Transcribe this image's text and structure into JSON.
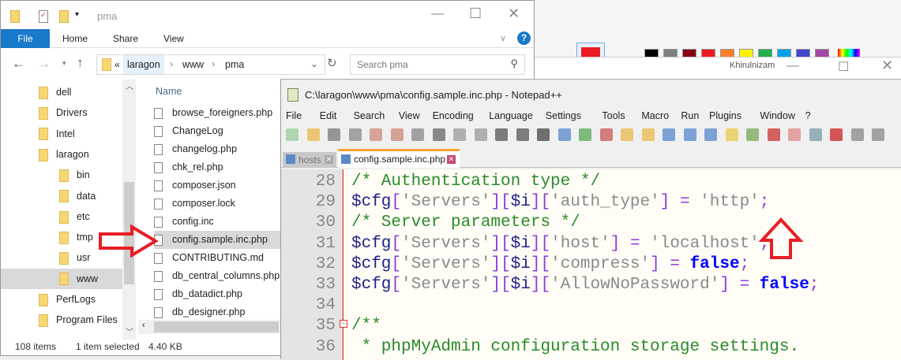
{
  "explorer": {
    "title": "pma",
    "tabs": [
      "File",
      "Home",
      "Share",
      "View"
    ],
    "breadcrumb": [
      "«",
      "laragon",
      "www",
      "pma"
    ],
    "search_placeholder": "Search pma",
    "nav_items": [
      "dell",
      "Drivers",
      "Intel",
      "laragon",
      "bin",
      "data",
      "etc",
      "tmp",
      "usr",
      "www",
      "PerfLogs",
      "Program Files"
    ],
    "selected_nav": "www",
    "column_header": "Name",
    "files": [
      "browse_foreigners.php",
      "ChangeLog",
      "changelog.php",
      "chk_rel.php",
      "composer.json",
      "composer.lock",
      "config.inc",
      "config.sample.inc.php",
      "CONTRIBUTING.md",
      "db_central_columns.php",
      "db_datadict.php",
      "db_designer.php"
    ],
    "selected_file": "config.sample.inc.php",
    "status": {
      "items": "108 items",
      "selected": "1 item selected",
      "size": "4.40 KB"
    }
  },
  "background_app": {
    "user": "Khirulnizam",
    "swatches": [
      "#000000",
      "#7f7f7f",
      "#880015",
      "#ed1c24",
      "#ff7f27",
      "#fff200",
      "#22b14c",
      "#00a2e8",
      "#3f48cc",
      "#a349a4"
    ],
    "current_color": "#ed1c24"
  },
  "notepad": {
    "title": "C:\\laragon\\www\\pma\\config.sample.inc.php - Notepad++",
    "menu": [
      "File",
      "Edit",
      "Search",
      "View",
      "Encoding",
      "Language",
      "Settings",
      "Tools",
      "Macro",
      "Run",
      "Plugins",
      "Window",
      "?"
    ],
    "tabs": [
      {
        "label": "hosts",
        "active": false
      },
      {
        "label": "config.sample.inc.php",
        "active": true
      }
    ],
    "lines": [
      {
        "n": "28",
        "t": [
          [
            "/* Authentication type */",
            "c"
          ]
        ]
      },
      {
        "n": "29",
        "t": [
          [
            "$cfg",
            "v"
          ],
          [
            "[",
            "p"
          ],
          [
            "'Servers'",
            "s"
          ],
          [
            "][",
            "p"
          ],
          [
            "$i",
            "v"
          ],
          [
            "][",
            "p"
          ],
          [
            "'auth_type'",
            "s"
          ],
          [
            "]",
            "p"
          ],
          [
            " = ",
            "o"
          ],
          [
            "'http'",
            "s"
          ],
          [
            ";",
            "p"
          ]
        ]
      },
      {
        "n": "30",
        "t": [
          [
            "/* Server parameters */",
            "c"
          ]
        ]
      },
      {
        "n": "31",
        "t": [
          [
            "$cfg",
            "v"
          ],
          [
            "[",
            "p"
          ],
          [
            "'Servers'",
            "s"
          ],
          [
            "][",
            "p"
          ],
          [
            "$i",
            "v"
          ],
          [
            "][",
            "p"
          ],
          [
            "'host'",
            "s"
          ],
          [
            "]",
            "p"
          ],
          [
            " = ",
            "o"
          ],
          [
            "'localhost'",
            "s"
          ],
          [
            ";",
            "p"
          ]
        ]
      },
      {
        "n": "32",
        "t": [
          [
            "$cfg",
            "v"
          ],
          [
            "[",
            "p"
          ],
          [
            "'Servers'",
            "s"
          ],
          [
            "][",
            "p"
          ],
          [
            "$i",
            "v"
          ],
          [
            "][",
            "p"
          ],
          [
            "'compress'",
            "s"
          ],
          [
            "]",
            "p"
          ],
          [
            " = ",
            "o"
          ],
          [
            "false",
            "k"
          ],
          [
            ";",
            "p"
          ]
        ]
      },
      {
        "n": "33",
        "t": [
          [
            "$cfg",
            "v"
          ],
          [
            "[",
            "p"
          ],
          [
            "'Servers'",
            "s"
          ],
          [
            "][",
            "p"
          ],
          [
            "$i",
            "v"
          ],
          [
            "][",
            "p"
          ],
          [
            "'AllowNoPassword'",
            "s"
          ],
          [
            "]",
            "p"
          ],
          [
            " = ",
            "o"
          ],
          [
            "false",
            "k"
          ],
          [
            ";",
            "p"
          ]
        ]
      },
      {
        "n": "34",
        "t": []
      },
      {
        "n": "35",
        "t": [
          [
            "/**",
            "c"
          ]
        ]
      },
      {
        "n": "36",
        "t": [
          [
            " * phpMyAdmin configuration storage settings.",
            "c"
          ]
        ]
      }
    ]
  }
}
